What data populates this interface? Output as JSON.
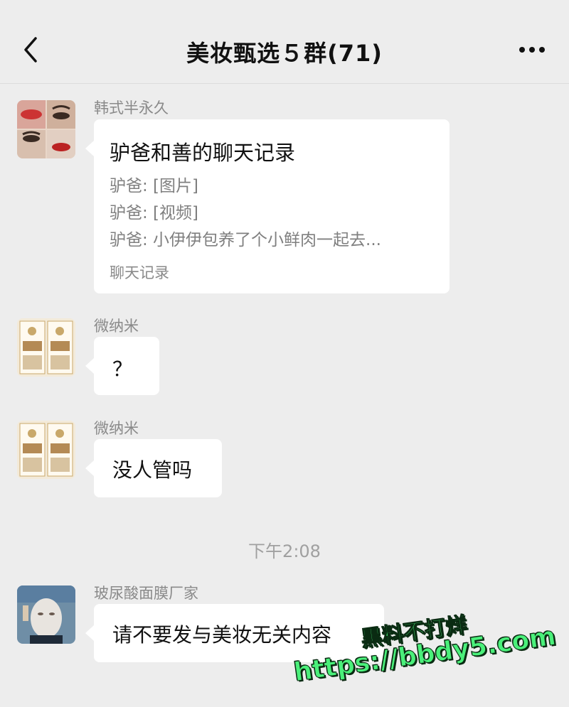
{
  "header": {
    "title": "美妆甄选５群(71)",
    "back_icon": "chevron-left-icon",
    "more_icon": "more-dots-icon"
  },
  "messages": [
    {
      "sender": "韩式半永久",
      "type": "chat-record-card",
      "card": {
        "title": "驴爸和善的聊天记录",
        "lines": [
          "驴爸: [图片]",
          "驴爸: [视频]",
          "驴爸: 小伊伊包养了个小鲜肉一起去..."
        ],
        "footer": "聊天记录"
      }
    },
    {
      "sender": "微纳米",
      "type": "text",
      "text": "？"
    },
    {
      "sender": "微纳米",
      "type": "text",
      "text": "没人管吗"
    },
    {
      "sender": "玻尿酸面膜厂家",
      "type": "text",
      "text": "请不要发与美妆无关内容"
    }
  ],
  "timestamp": "下午2:08",
  "watermark": {
    "line1": "黑料不打烊",
    "line2": "https://bbdy5.com"
  },
  "colors": {
    "background": "#ededed",
    "bubble": "#ffffff",
    "watermark": "#4af07a"
  }
}
